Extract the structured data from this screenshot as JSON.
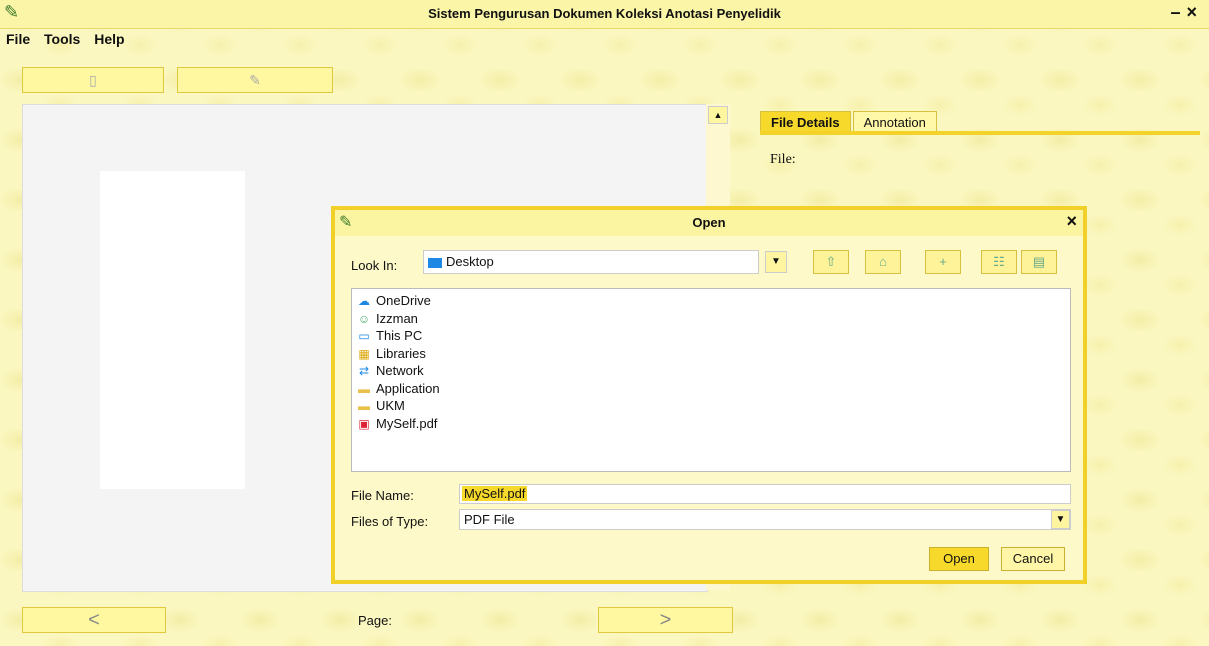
{
  "app": {
    "title": "Sistem Pengurusan Dokumen Koleksi Anotasi Penyelidik"
  },
  "menu": [
    "File",
    "Tools",
    "Help"
  ],
  "tabs": [
    {
      "label": "File Details",
      "active": true
    },
    {
      "label": "Annotation",
      "active": false
    }
  ],
  "details": {
    "file_label": "File:"
  },
  "nav": {
    "page_label": "Page:"
  },
  "dialog": {
    "title": "Open",
    "look_in_label": "Look In:",
    "look_in_value": "Desktop",
    "files": [
      {
        "name": "OneDrive",
        "icon": "cloud-icon"
      },
      {
        "name": "Izzman",
        "icon": "user-icon"
      },
      {
        "name": "This PC",
        "icon": "computer-icon"
      },
      {
        "name": "Libraries",
        "icon": "libraries-icon"
      },
      {
        "name": "Network",
        "icon": "network-icon"
      },
      {
        "name": "Application",
        "icon": "folder-icon"
      },
      {
        "name": "UKM",
        "icon": "folder-icon"
      },
      {
        "name": "MySelf.pdf",
        "icon": "pdf-icon"
      }
    ],
    "file_name_label": "File Name:",
    "file_name_value": "MySelf.pdf",
    "files_of_type_label": "Files of Type:",
    "files_of_type_value": "PDF File",
    "open_button": "Open",
    "cancel_button": "Cancel"
  },
  "colors": {
    "accent": "#f3d32a",
    "background": "#fbf7c0",
    "link_blue": "#1e88e5"
  }
}
